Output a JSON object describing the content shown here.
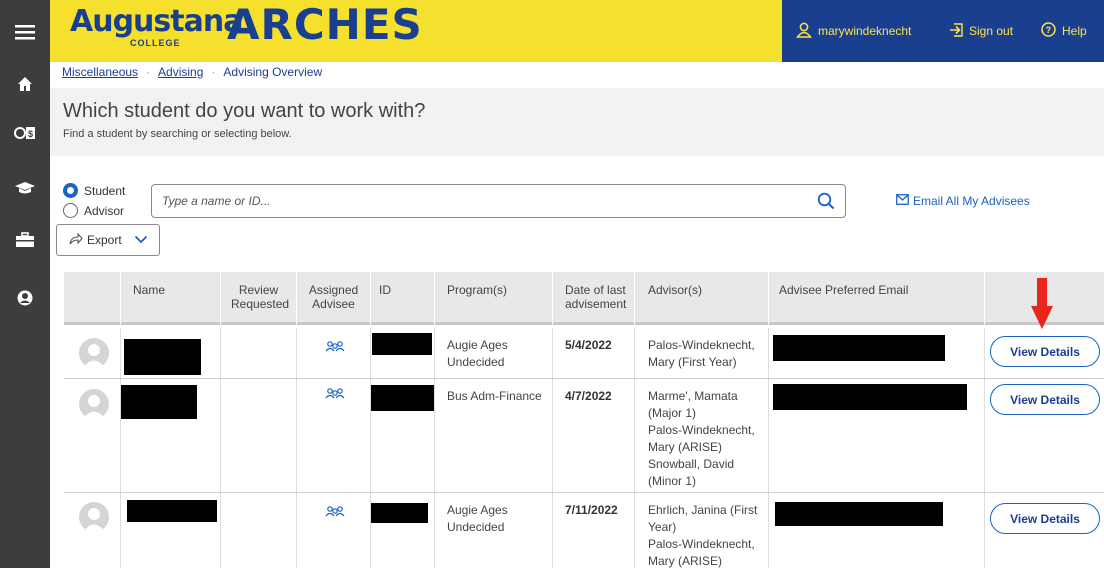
{
  "header": {
    "logo_word": "Augustana",
    "logo_sub": "COLLEGE",
    "logo_app": "ARCHES",
    "user": "marywindeknecht",
    "sign_out": "Sign out",
    "help": "Help"
  },
  "sidebar": {
    "icons": [
      "menu-icon",
      "home-icon",
      "financial-icon",
      "graduation-cap-icon",
      "briefcase-icon",
      "user-circle-icon"
    ]
  },
  "breadcrumb": [
    "Miscellaneous",
    "Advising",
    "Advising Overview"
  ],
  "page": {
    "title": "Which student do you want to work with?",
    "subtitle": "Find a student by searching or selecting below."
  },
  "search": {
    "mode_student": "Student",
    "mode_advisor": "Advisor",
    "selected_mode": "Student",
    "placeholder": "Type a name or ID...",
    "email_all": "Email All My Advisees",
    "export": "Export"
  },
  "table": {
    "headers": [
      "Name",
      "Review Requested",
      "Assigned Advisee",
      "ID",
      "Program(s)",
      "Date of last advisement",
      "Advisor(s)",
      "Advisee Preferred Email"
    ],
    "action_label": "View Details",
    "rows": [
      {
        "programs": [
          "Augie Ages",
          "Undecided"
        ],
        "date": "5/4/2022",
        "advisors": [
          "Palos-Windeknecht,",
          "Mary (First Year)"
        ]
      },
      {
        "programs": [
          "Bus Adm-Finance"
        ],
        "date": "4/7/2022",
        "advisors": [
          "Marme', Mamata",
          "(Major 1)",
          "Palos-Windeknecht,",
          "Mary (ARISE)",
          "Snowball, David",
          "(Minor 1)"
        ]
      },
      {
        "programs": [
          "Augie Ages",
          "Undecided"
        ],
        "date": "7/11/2022",
        "advisors": [
          "Ehrlich, Janina (First",
          "Year)",
          "Palos-Windeknecht,",
          "Mary (ARISE)"
        ]
      }
    ]
  },
  "colors": {
    "header_yellow": "#f5e02e",
    "header_blue": "#1b3f8f",
    "sidebar": "#3d3d3d",
    "link_blue": "#1b62c4",
    "arrow_red": "#e8261c"
  }
}
